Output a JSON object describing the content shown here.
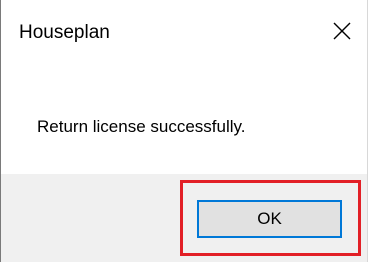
{
  "dialog": {
    "title": "Houseplan",
    "message": "Return license successfully.",
    "ok_label": "OK",
    "close_icon": "close-icon",
    "colors": {
      "highlight": "#e21f26",
      "button_focus": "#0078d7",
      "footer_bg": "#f0f0f0"
    }
  }
}
